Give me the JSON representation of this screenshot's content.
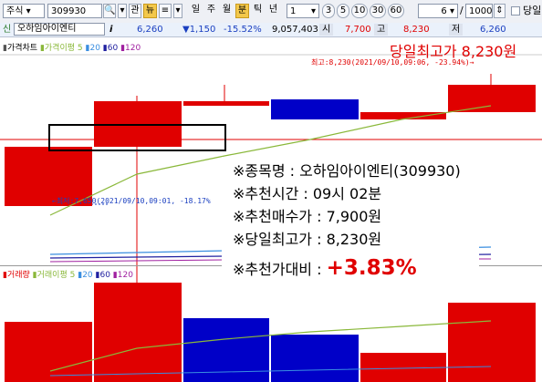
{
  "toolbar": {
    "market": "주식",
    "code": "309930",
    "btn_gwan": "관",
    "btn_nyu": "뉴",
    "period_tabs": [
      "일",
      "주",
      "월",
      "분",
      "틱",
      "년"
    ],
    "active_period": "분",
    "interval_value": "1",
    "minute_options": [
      "3",
      "5",
      "10",
      "30",
      "60"
    ],
    "count_value": "6",
    "count_sep": "/",
    "count_total": "1000",
    "option_label": "당일"
  },
  "quote": {
    "flag": "신",
    "name": "오하임아이엔티",
    "info_icon": "i",
    "price": "6,260",
    "change": "▼1,150",
    "change_pct": "-15.52%",
    "volume": "9,057,403",
    "open_label": "시",
    "open": "7,700",
    "high_label": "고",
    "high": "8,230",
    "low_label": "저",
    "low": "6,260"
  },
  "price_legend": {
    "title": "가격차트",
    "ma_label": "가격이평",
    "ma": [
      "5",
      "20",
      "60",
      "120"
    ]
  },
  "volume_legend": {
    "title": "거래량",
    "ma_label": "거래이평",
    "ma": [
      "5",
      "20",
      "60",
      "120"
    ]
  },
  "annotations": {
    "headline": "당일최고가 8,230원",
    "high_note": "최고:8,230(2021/09/10,09:06, -23.94%)→",
    "low_note": "←최저:7,650(2021/09/10,09:01, -18.17%"
  },
  "info": {
    "line1": "※종목명 : 오하임아이엔티(309930)",
    "line2": "※추천시간 : 09시 02분",
    "line3": "※추천매수가 : 7,900원",
    "line4": "※당일최고가 : 8,230원",
    "line5_label": "※추천가대비 : ",
    "line5_value": "+3.83%"
  },
  "colors": {
    "up": "#e00000",
    "down": "#0000c8",
    "ma5": "#8ab83a",
    "accent": "#f3c84b"
  },
  "chart_data": {
    "type": "candlestick",
    "title": "",
    "candles": [
      {
        "open": 7790,
        "close": 7650,
        "color": "blue"
      },
      {
        "open": 7700,
        "close": 8000,
        "color": "red"
      },
      {
        "open": 7980,
        "close": 7990,
        "color": "red"
      },
      {
        "open": 7970,
        "close": 7900,
        "color": "blue"
      },
      {
        "open": 7890,
        "close": 7930,
        "color": "red"
      },
      {
        "open": 7990,
        "close": 8100,
        "color": "red"
      }
    ],
    "volume": [
      {
        "value": 0.55,
        "color": "red"
      },
      {
        "value": 0.93,
        "color": "red"
      },
      {
        "value": 0.62,
        "color": "blue"
      },
      {
        "value": 0.45,
        "color": "blue"
      },
      {
        "value": 0.28,
        "color": "red"
      },
      {
        "value": 0.72,
        "color": "red"
      }
    ]
  }
}
